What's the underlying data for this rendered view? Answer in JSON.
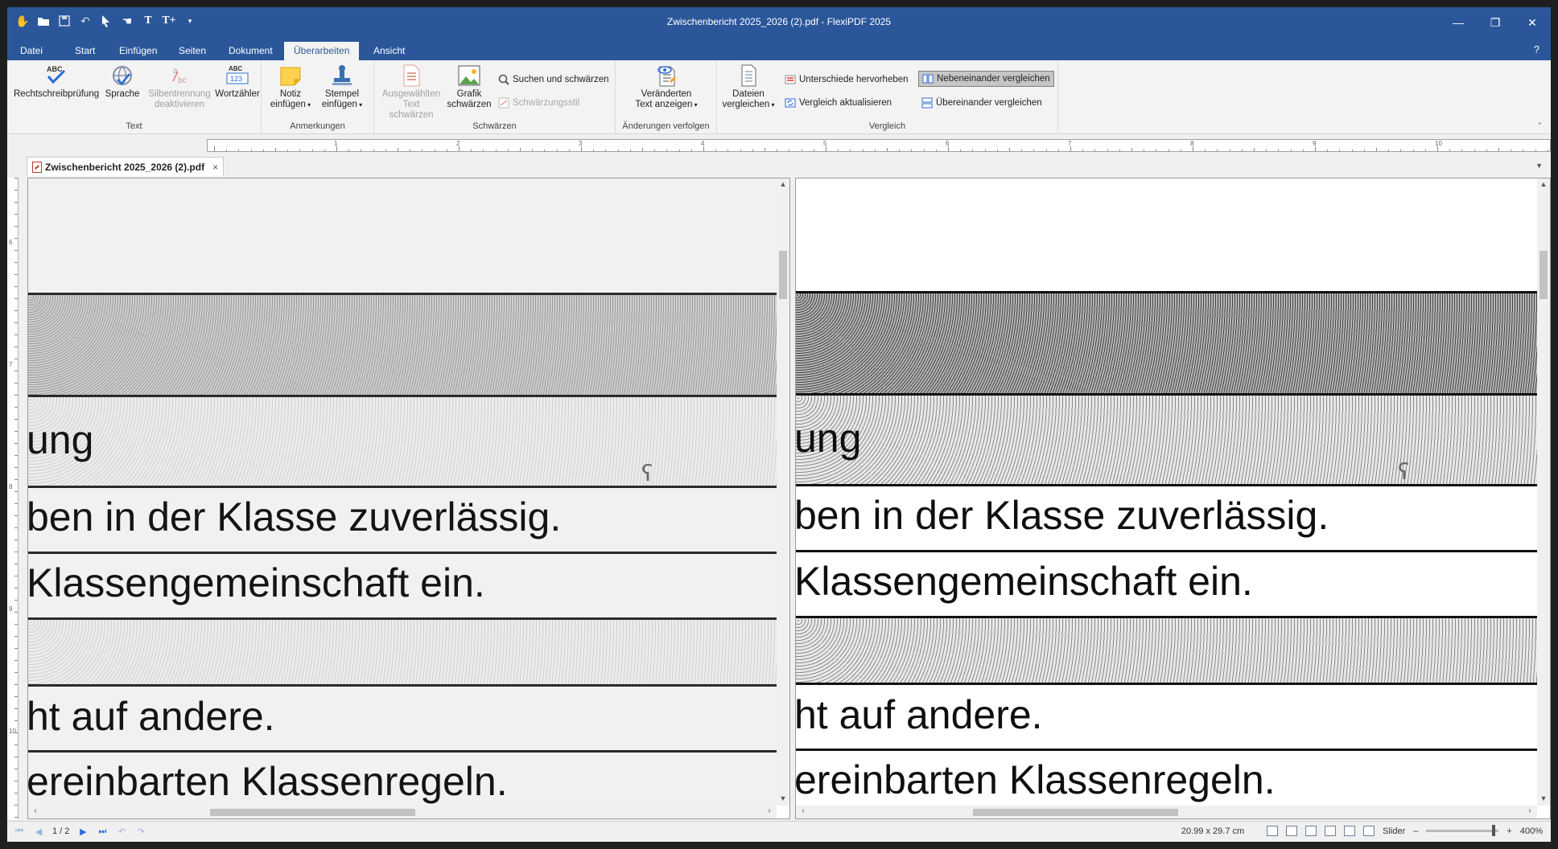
{
  "window": {
    "title": "Zwischenbericht 2025_2026 (2).pdf - FlexiPDF 2025",
    "controls": [
      "minimize-icon",
      "restore-icon",
      "close-icon"
    ]
  },
  "quick_access": [
    "hand-icon",
    "open-folder-icon",
    "save-icon",
    "undo-icon",
    "select-arrow-icon",
    "pan-hand-icon",
    "text-tool-icon",
    "text-plus-icon",
    "customize-chevron-icon"
  ],
  "menu": {
    "tabs": [
      "Datei",
      "Start",
      "Einfügen",
      "Seiten",
      "Dokument",
      "Überarbeiten",
      "Ansicht"
    ],
    "active": "Überarbeiten",
    "help": "?"
  },
  "ribbon": {
    "text_group": {
      "label": "Text",
      "spellcheck": "Rechtschreibprüfung",
      "language": "Sprache",
      "hyphen_1": "Silbentrennung",
      "hyphen_2": "deaktivieren",
      "wordcount": "Wortzähler"
    },
    "notes_group": {
      "label": "Anmerkungen",
      "note_1": "Notiz",
      "note_2": "einfügen",
      "stamp_1": "Stempel",
      "stamp_2": "einfügen"
    },
    "redact_group": {
      "label": "Schwärzen",
      "sel_1": "Ausgewählten",
      "sel_2": "Text schwärzen",
      "graphic_1": "Grafik",
      "graphic_2": "schwärzen",
      "search": "Suchen und schwärzen",
      "style": "Schwärzungsstil"
    },
    "track_group": {
      "label": "Änderungen verfolgen",
      "changed_1": "Veränderten",
      "changed_2": "Text anzeigen"
    },
    "compare_group": {
      "label": "Vergleich",
      "files_1": "Dateien",
      "files_2": "vergleichen",
      "highlight": "Unterschiede hervorheben",
      "refresh": "Vergleich aktualisieren",
      "side_by_side": "Nebeneinander vergleichen",
      "stacked": "Übereinander vergleichen"
    }
  },
  "ruler": {
    "numbers": [
      "1",
      "2",
      "3",
      "4",
      "5",
      "6",
      "7",
      "8",
      "9",
      "10"
    ],
    "vertical_numbers": [
      "6",
      "7",
      "8",
      "9",
      "10"
    ]
  },
  "document_tab": {
    "name": "Zwischenbericht 2025_2026 (2).pdf",
    "close": "×"
  },
  "page_content": {
    "lines": [
      "ung",
      "ben in der Klasse zuverlässig.",
      " Klassengemeinschaft ein.",
      "ht auf andere.",
      "ereinbarten Klassenregeln."
    ]
  },
  "statusbar": {
    "page": "1 / 2",
    "page_size": "20.99 x 29.7 cm",
    "mode": "Slider",
    "zoom_minus": "–",
    "zoom_plus": "+",
    "zoom": "400%",
    "zoom_level": 0.95
  }
}
